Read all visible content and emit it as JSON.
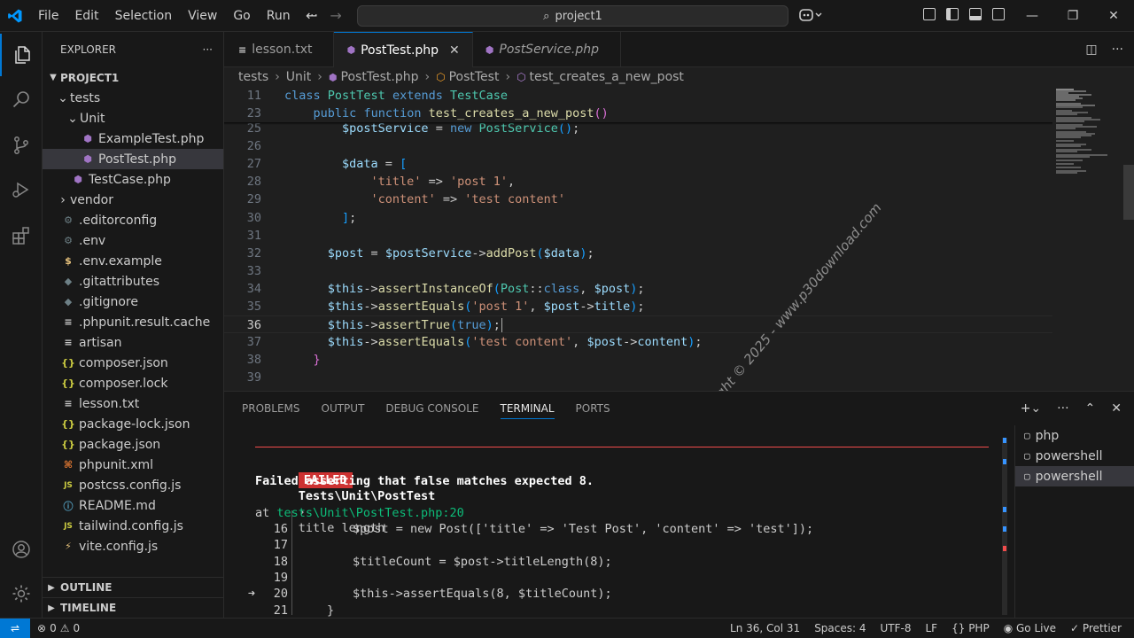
{
  "titlebar": {
    "menu": [
      "File",
      "Edit",
      "Selection",
      "View",
      "Go",
      "Run",
      "···"
    ],
    "search": "project1"
  },
  "explorer": {
    "title": "EXPLORER",
    "more": "···",
    "project": "PROJECT1",
    "tree": [
      {
        "label": "tests",
        "type": "folder-open",
        "indent": 1
      },
      {
        "label": "Unit",
        "type": "folder-open",
        "indent": 2
      },
      {
        "label": "ExampleTest.php",
        "type": "php",
        "indent": 3
      },
      {
        "label": "PostTest.php",
        "type": "php",
        "indent": 3,
        "selected": true
      },
      {
        "label": "TestCase.php",
        "type": "php",
        "indent": 2
      },
      {
        "label": "vendor",
        "type": "folder",
        "indent": 1
      },
      {
        "label": ".editorconfig",
        "type": "gear",
        "indent": 1
      },
      {
        "label": ".env",
        "type": "gear",
        "indent": 1
      },
      {
        "label": ".env.example",
        "type": "dollar",
        "indent": 1
      },
      {
        "label": ".gitattributes",
        "type": "dot",
        "indent": 1
      },
      {
        "label": ".gitignore",
        "type": "dot",
        "indent": 1
      },
      {
        "label": ".phpunit.result.cache",
        "type": "lines",
        "indent": 1
      },
      {
        "label": "artisan",
        "type": "lines",
        "indent": 1
      },
      {
        "label": "composer.json",
        "type": "json",
        "indent": 1
      },
      {
        "label": "composer.lock",
        "type": "json",
        "indent": 1
      },
      {
        "label": "lesson.txt",
        "type": "lines",
        "indent": 1
      },
      {
        "label": "package-lock.json",
        "type": "json",
        "indent": 1
      },
      {
        "label": "package.json",
        "type": "json",
        "indent": 1
      },
      {
        "label": "phpunit.xml",
        "type": "xml",
        "indent": 1
      },
      {
        "label": "postcss.config.js",
        "type": "js",
        "indent": 1
      },
      {
        "label": "README.md",
        "type": "info",
        "indent": 1
      },
      {
        "label": "tailwind.config.js",
        "type": "js",
        "indent": 1
      },
      {
        "label": "vite.config.js",
        "type": "bolt",
        "indent": 1
      }
    ],
    "outline": "OUTLINE",
    "timeline": "TIMELINE"
  },
  "tabs": [
    {
      "label": "lesson.txt",
      "icon": "lines",
      "active": false,
      "italic": false
    },
    {
      "label": "PostTest.php",
      "icon": "php",
      "active": true,
      "italic": false
    },
    {
      "label": "PostService.php",
      "icon": "php",
      "active": false,
      "italic": true
    }
  ],
  "breadcrumb": [
    "tests",
    "Unit",
    "PostTest.php",
    "PostTest",
    "test_creates_a_new_post"
  ],
  "editor": {
    "sticky": [
      {
        "n": "11",
        "html": "<span class=\"k\">class</span> <span class=\"c\">PostTest</span> <span class=\"k\">extends</span> <span class=\"c\">TestCase</span>"
      },
      {
        "n": "23",
        "html": "    <span class=\"k\">public</span> <span class=\"k\">function</span> <span class=\"f\">test_creates_a_new_post</span><span class=\"b2\">()</span>"
      }
    ],
    "lines": [
      {
        "n": "25",
        "html": "        <span class=\"v\">$postService</span> = <span class=\"k\">new</span> <span class=\"c\">PostService</span><span class=\"b3\">()</span>;"
      },
      {
        "n": "26",
        "html": ""
      },
      {
        "n": "27",
        "html": "        <span class=\"v\">$data</span> = <span class=\"b3\">[</span>"
      },
      {
        "n": "28",
        "html": "            <span class=\"s\">'title'</span> =&gt; <span class=\"s\">'post 1'</span>,"
      },
      {
        "n": "29",
        "html": "            <span class=\"s\">'content'</span> =&gt; <span class=\"s\">'test content'</span>"
      },
      {
        "n": "30",
        "html": "        <span class=\"b3\">]</span>;"
      },
      {
        "n": "31",
        "html": ""
      },
      {
        "n": "32",
        "html": "      <span class=\"v\">$post</span> = <span class=\"v\">$postService</span>-&gt;<span class=\"f\">addPost</span><span class=\"b3\">(</span><span class=\"v\">$data</span><span class=\"b3\">)</span>;"
      },
      {
        "n": "33",
        "html": ""
      },
      {
        "n": "34",
        "html": "      <span class=\"v\">$this</span>-&gt;<span class=\"f\">assertInstanceOf</span><span class=\"b3\">(</span><span class=\"c\">Post</span>::<span class=\"k\">class</span>, <span class=\"v\">$post</span><span class=\"b3\">)</span>;"
      },
      {
        "n": "35",
        "html": "      <span class=\"v\">$this</span>-&gt;<span class=\"f\">assertEquals</span><span class=\"b3\">(</span><span class=\"s\">'post 1'</span>, <span class=\"v\">$post</span>-&gt;<span class=\"v\">title</span><span class=\"b3\">)</span>;"
      },
      {
        "n": "36",
        "html": "      <span class=\"v\">$this</span>-&gt;<span class=\"f\">assertTrue</span><span class=\"b3\">(</span><span class=\"k\">true</span><span class=\"b3\">)</span>;",
        "current": true
      },
      {
        "n": "37",
        "html": "      <span class=\"v\">$this</span>-&gt;<span class=\"f\">assertEquals</span><span class=\"b3\">(</span><span class=\"s\">'test content'</span>, <span class=\"v\">$post</span>-&gt;<span class=\"v\">content</span><span class=\"b3\">)</span>;"
      },
      {
        "n": "38",
        "html": "    <span class=\"b2\">}</span>"
      },
      {
        "n": "39",
        "html": ""
      }
    ],
    "watermark": "Copyright © 2025 - www.p30download.com"
  },
  "panel": {
    "tabs": [
      "PROBLEMS",
      "OUTPUT",
      "DEBUG CONSOLE",
      "TERMINAL",
      "PORTS"
    ],
    "active_tab": "TERMINAL",
    "terminal": {
      "failed_badge": "FAILED",
      "test_name": "Tests\\Unit\\PostTest",
      "test_case": "title length",
      "message": "Failed asserting that false matches expected 8.",
      "at_prefix": "at ",
      "at_location": "tests\\Unit\\PostTest.php:20",
      "code": [
        {
          "n": "16",
          "text": "$post = new Post(['title' => 'Test Post', 'content' => 'test']);",
          "arrow": false
        },
        {
          "n": "17",
          "text": "",
          "arrow": false
        },
        {
          "n": "18",
          "text": "$titleCount = $post->titleLength(8);",
          "arrow": false
        },
        {
          "n": "19",
          "text": "",
          "arrow": false
        },
        {
          "n": "20",
          "text": "$this->assertEquals(8, $titleCount);",
          "arrow": true
        },
        {
          "n": "21",
          "text": "}",
          "arrow": false,
          "indent_small": true
        }
      ]
    },
    "terminals": [
      {
        "label": "php",
        "selected": false
      },
      {
        "label": "powershell",
        "selected": false
      },
      {
        "label": "powershell",
        "selected": true
      }
    ]
  },
  "statusbar": {
    "errors": "0",
    "warnings": "0",
    "cursor": "Ln 36, Col 31",
    "spaces": "Spaces: 4",
    "encoding": "UTF-8",
    "eol": "LF",
    "language": "PHP",
    "golive": "Go Live",
    "prettier": "Prettier"
  },
  "colors": {
    "accent": "#0078d4",
    "failed": "#cd3131",
    "php_icon": "#a074c4"
  }
}
